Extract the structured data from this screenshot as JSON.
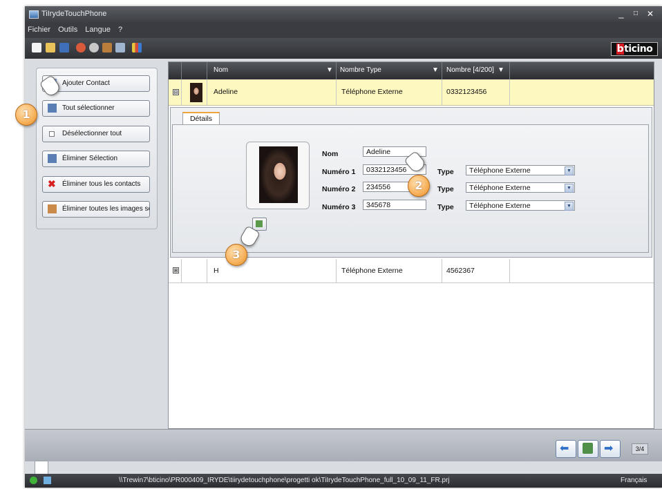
{
  "window": {
    "title": "TiIrydeTouchPhone"
  },
  "menu": [
    "Fichier",
    "Outils",
    "Langue",
    "?"
  ],
  "brand": {
    "logo_text": "bticino"
  },
  "left_panel": {
    "buttons": [
      {
        "label": "Ajouter Contact",
        "icon": "add-contact-icon"
      },
      {
        "label": "Tout sélectionner",
        "icon": "select-all-icon"
      },
      {
        "label": "Désélectionner tout",
        "icon": "deselect-icon"
      },
      {
        "label": "Éliminer Sélection",
        "icon": "delete-selection-icon"
      },
      {
        "label": "Éliminer tous les contacts",
        "icon": "delete-all-icon"
      },
      {
        "label": "Éliminer toutes les images sélec",
        "icon": "delete-images-icon"
      }
    ]
  },
  "grid": {
    "columns": [
      "Nom",
      "Nombre Type",
      "Nombre [4/200]"
    ],
    "rows": [
      {
        "expander": "⊟",
        "name": "Adeline",
        "type": "Téléphone Externe",
        "number": "0332123456"
      },
      {
        "expander": "⊞",
        "name": "H",
        "type": "Téléphone Externe",
        "number": "4562367"
      }
    ]
  },
  "details": {
    "tab_label": "Détails",
    "labels": {
      "nom": "Nom",
      "numero1": "Numéro 1",
      "numero2": "Numéro 2",
      "numero3": "Numéro 3",
      "type": "Type"
    },
    "values": {
      "nom": "Adeline",
      "numero1": "0332123456",
      "numero2": "234556",
      "numero3": "345678"
    },
    "types": [
      "Téléphone Externe",
      "Téléphone Externe",
      "Téléphone Externe"
    ]
  },
  "pagination": {
    "page": "3/4"
  },
  "status": {
    "path": "\\\\Trewin7\\bticino\\PR000409_IRYDE\\tiirydetouchphone\\progetti ok\\TiIrydeTouchPhone_full_10_09_11_FR.prj",
    "language": "Français"
  },
  "callouts": [
    "1",
    "2",
    "3"
  ],
  "colors": {
    "selected_row": "#fdf7c0",
    "callout": "#f6b15a",
    "tab_accent": "#f0a33a"
  }
}
